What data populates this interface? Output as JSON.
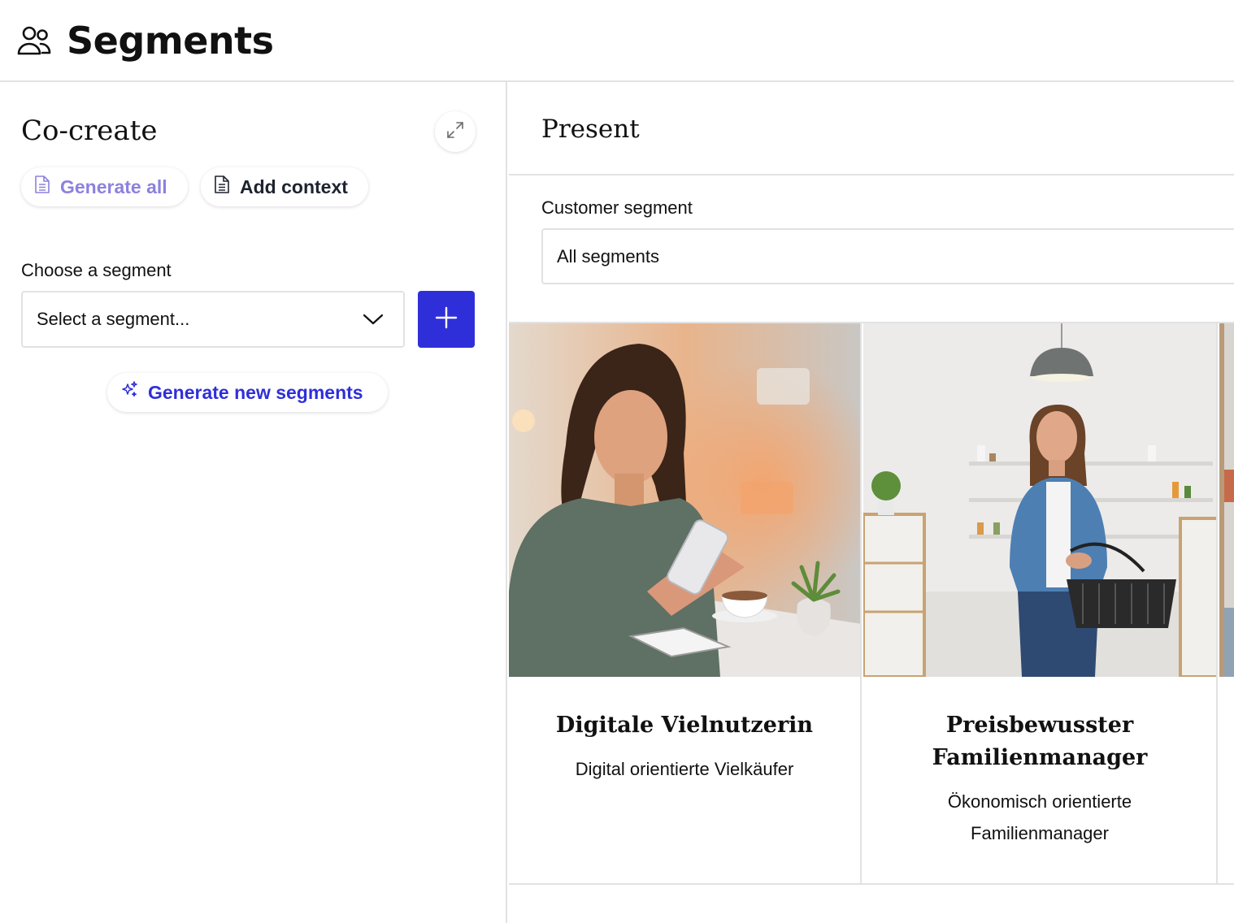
{
  "header": {
    "title": "Segments",
    "icon": "users-icon"
  },
  "cocreate": {
    "title": "Co-create",
    "expand_icon": "expand-icon",
    "generate_all_label": "Generate all",
    "add_context_label": "Add context",
    "choose_label": "Choose a segment",
    "select_placeholder": "Select a segment...",
    "generate_new_label": "Generate new segments",
    "colors": {
      "accent": "#2f2fd9",
      "generate_all_text": "#8b82dd"
    }
  },
  "present": {
    "title": "Present",
    "customer_segment_label": "Customer segment",
    "customer_segment_value": "All segments",
    "cards": [
      {
        "name": "Digitale Vielnutzerin",
        "description": "Digital orientierte Vielkäufer"
      },
      {
        "name": "Preisbewusster Familienmanager",
        "description": "Ökonomisch orientierte Familienmanager"
      }
    ]
  }
}
